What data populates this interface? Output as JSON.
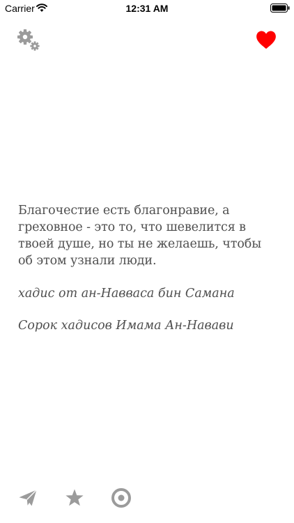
{
  "status_bar": {
    "carrier": "Carrier",
    "time": "12:31 AM",
    "wifi_icon": "wifi-icon",
    "battery_icon": "battery-icon"
  },
  "toolbar": {
    "settings_icon": "gears-icon",
    "favorite_icon": "heart-icon"
  },
  "quote": {
    "text": "Благочестие есть благонравие, а греховное - это то, что шевелится в твоей душе, но ты не желаешь, чтобы об этом узнали люди.",
    "narrator": "хадис от ан-Навваса бин Самана",
    "source": "Сорок хадисов Имама Ан-Навави"
  },
  "bottom_bar": {
    "share_icon": "paper-plane-icon",
    "star_icon": "star-icon",
    "target_icon": "target-icon"
  },
  "colors": {
    "accent_heart": "#ff0000",
    "icon_gray": "#9b9b9b",
    "text_gray": "#4f4f4f"
  }
}
